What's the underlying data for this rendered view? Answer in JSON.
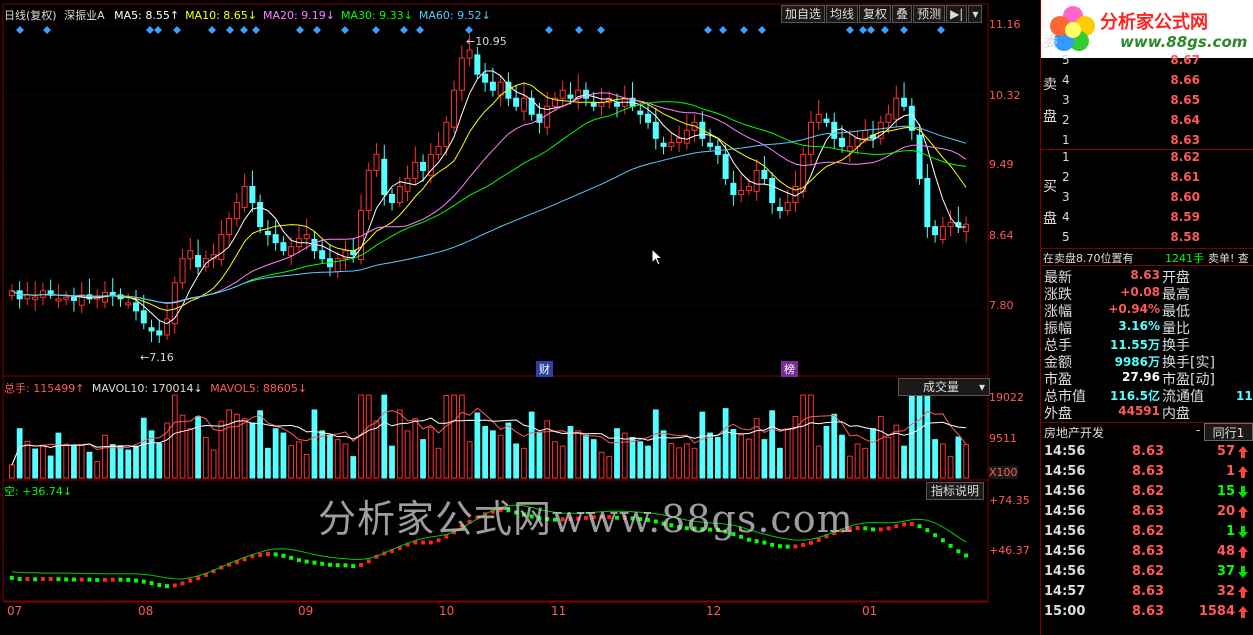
{
  "header": {
    "title": "日线(复权)",
    "stock_name": "深振业A",
    "ma_items": [
      {
        "label": "MA5: 8.55",
        "dir": "↑",
        "color": "#ffffff"
      },
      {
        "label": "MA10: 8.65",
        "dir": "↓",
        "color": "#ffff00"
      },
      {
        "label": "MA20: 9.19",
        "dir": "↓",
        "color": "#ff80ff"
      },
      {
        "label": "MA30: 9.33",
        "dir": "↓",
        "color": "#00ff00"
      },
      {
        "label": "MA60: 9.52",
        "dir": "↓",
        "color": "#5ac8ff"
      }
    ]
  },
  "toolbar": {
    "buttons": [
      "加自选",
      "均线",
      "复权",
      "叠",
      "预测",
      "▶|",
      "▾"
    ]
  },
  "logo": {
    "text": "分析家公式网",
    "url": "www.88gs.com"
  },
  "price_axis": [
    "11.16",
    "10.32",
    "9.49",
    "8.64",
    "7.80"
  ],
  "price_markers": {
    "high": "10.95",
    "low": "7.16"
  },
  "event_tags": [
    "财",
    "榜"
  ],
  "volume": {
    "label_total": "总手: 115499↑",
    "label_mavol10": "MAVOL10: 170014↓",
    "label_mavol5": "MAVOL5: 88605↓",
    "axis": [
      "19022",
      "9511",
      "X100"
    ],
    "dropdown": "成交量"
  },
  "indicator": {
    "label": "空: +36.74↓",
    "axis": [
      "+74.35",
      "+46.37"
    ],
    "button": "指标说明"
  },
  "months": [
    "07",
    "08",
    "09",
    "10",
    "11",
    "12",
    "01"
  ],
  "watermark": "分析家公式网www.88gs.com",
  "colors": {
    "up": "#ff3030",
    "down": "#54ffff",
    "bg": "#000000",
    "grid": "#800000"
  },
  "orderbook": {
    "sell_label": [
      "卖",
      "盘"
    ],
    "buy_label": [
      "买",
      "盘"
    ],
    "sell": [
      {
        "level": "5",
        "price": "8.67"
      },
      {
        "level": "4",
        "price": "8.66"
      },
      {
        "level": "3",
        "price": "8.65"
      },
      {
        "level": "2",
        "price": "8.64"
      },
      {
        "level": "1",
        "price": "8.63"
      }
    ],
    "buy": [
      {
        "level": "1",
        "price": "8.62"
      },
      {
        "level": "2",
        "price": "8.61"
      },
      {
        "level": "3",
        "price": "8.60"
      },
      {
        "level": "4",
        "price": "8.59"
      },
      {
        "level": "5",
        "price": "8.58"
      }
    ],
    "status_left": "在卖盘8.70位置有",
    "status_vol": "1241手",
    "status_right": "卖单! 查"
  },
  "quote": [
    {
      "label": "最新",
      "value": "8.63",
      "label2": "开盘",
      "color": "#ff5a5a"
    },
    {
      "label": "涨跌",
      "value": "+0.08",
      "label2": "最高",
      "color": "#ff5a5a"
    },
    {
      "label": "涨幅",
      "value": "+0.94%",
      "label2": "最低",
      "color": "#ff5a5a"
    },
    {
      "label": "振幅",
      "value": "3.16%",
      "label2": "量比",
      "color": "#54ffff"
    },
    {
      "label": "总手",
      "value": "11.55万",
      "label2": "换手",
      "color": "#54ffff"
    },
    {
      "label": "金额",
      "value": "9986万",
      "label2": "换手[实]",
      "color": "#54ffff"
    },
    {
      "label": "市盈",
      "value": "27.96",
      "label2": "市盈[动]",
      "color": "#ffffff"
    },
    {
      "label": "总市值",
      "value": "116.5亿",
      "label2": "流通值",
      "color": "#54ffff"
    },
    {
      "label": "外盘",
      "value": "44591",
      "label2": "内盘",
      "color": "#ff5a5a"
    }
  ],
  "quote_extra": "11",
  "sector": {
    "name": "房地产开发",
    "sep": "-",
    "tab": "同行1"
  },
  "ticks": [
    {
      "time": "14:56",
      "price": "8.63",
      "vol": "57",
      "dir": "up"
    },
    {
      "time": "14:56",
      "price": "8.63",
      "vol": "1",
      "dir": "up"
    },
    {
      "time": "14:56",
      "price": "8.62",
      "vol": "15",
      "dir": "down"
    },
    {
      "time": "14:56",
      "price": "8.63",
      "vol": "20",
      "dir": "up"
    },
    {
      "time": "14:56",
      "price": "8.62",
      "vol": "1",
      "dir": "down"
    },
    {
      "time": "14:56",
      "price": "8.63",
      "vol": "48",
      "dir": "up"
    },
    {
      "time": "14:56",
      "price": "8.62",
      "vol": "37",
      "dir": "down"
    },
    {
      "time": "14:57",
      "price": "8.63",
      "vol": "32",
      "dir": "up"
    },
    {
      "time": "15:00",
      "price": "8.63",
      "vol": "1584",
      "dir": "up"
    }
  ],
  "chart_data": {
    "type": "candlestick",
    "x_months": [
      "07",
      "08",
      "09",
      "10",
      "11",
      "12",
      "01"
    ],
    "ylim": [
      7.0,
      11.2
    ],
    "ma": {
      "MA5": 8.55,
      "MA10": 8.65,
      "MA20": 9.19,
      "MA30": 9.33,
      "MA60": 9.52
    },
    "series_closes": [
      7.8,
      7.7,
      7.75,
      7.72,
      7.8,
      7.76,
      7.7,
      7.72,
      7.68,
      7.75,
      7.7,
      7.72,
      7.78,
      7.75,
      7.7,
      7.65,
      7.55,
      7.4,
      7.3,
      7.25,
      7.45,
      7.9,
      8.2,
      8.3,
      8.1,
      8.2,
      8.25,
      8.5,
      8.7,
      8.9,
      9.1,
      8.9,
      8.6,
      8.5,
      8.4,
      8.3,
      8.35,
      8.45,
      8.5,
      8.3,
      8.2,
      8.1,
      8.2,
      8.3,
      8.25,
      8.8,
      9.3,
      9.5,
      9.0,
      8.9,
      9.1,
      9.2,
      9.4,
      9.3,
      9.5,
      9.6,
      9.9,
      10.3,
      10.7,
      10.8,
      10.5,
      10.4,
      10.3,
      10.4,
      10.2,
      10.1,
      10.2,
      10.0,
      9.9,
      10.1,
      10.2,
      10.3,
      10.2,
      10.3,
      10.2,
      10.1,
      10.15,
      10.2,
      10.1,
      10.2,
      10.1,
      10.0,
      9.9,
      9.7,
      9.6,
      9.65,
      9.7,
      9.8,
      9.9,
      9.7,
      9.6,
      9.5,
      9.2,
      9.0,
      9.05,
      9.1,
      9.3,
      9.2,
      8.9,
      8.8,
      8.9,
      9.1,
      9.5,
      9.9,
      10.0,
      9.9,
      9.7,
      9.6,
      9.6,
      9.7,
      9.8,
      9.7,
      9.9,
      10.0,
      10.2,
      10.1,
      9.8,
      9.2,
      8.6,
      8.5,
      8.6,
      8.65,
      8.6,
      8.63
    ],
    "volume_units": "X100",
    "volume_ylim": [
      0,
      19022
    ],
    "indicator_axis": [
      "+74.35",
      "+46.37"
    ]
  }
}
